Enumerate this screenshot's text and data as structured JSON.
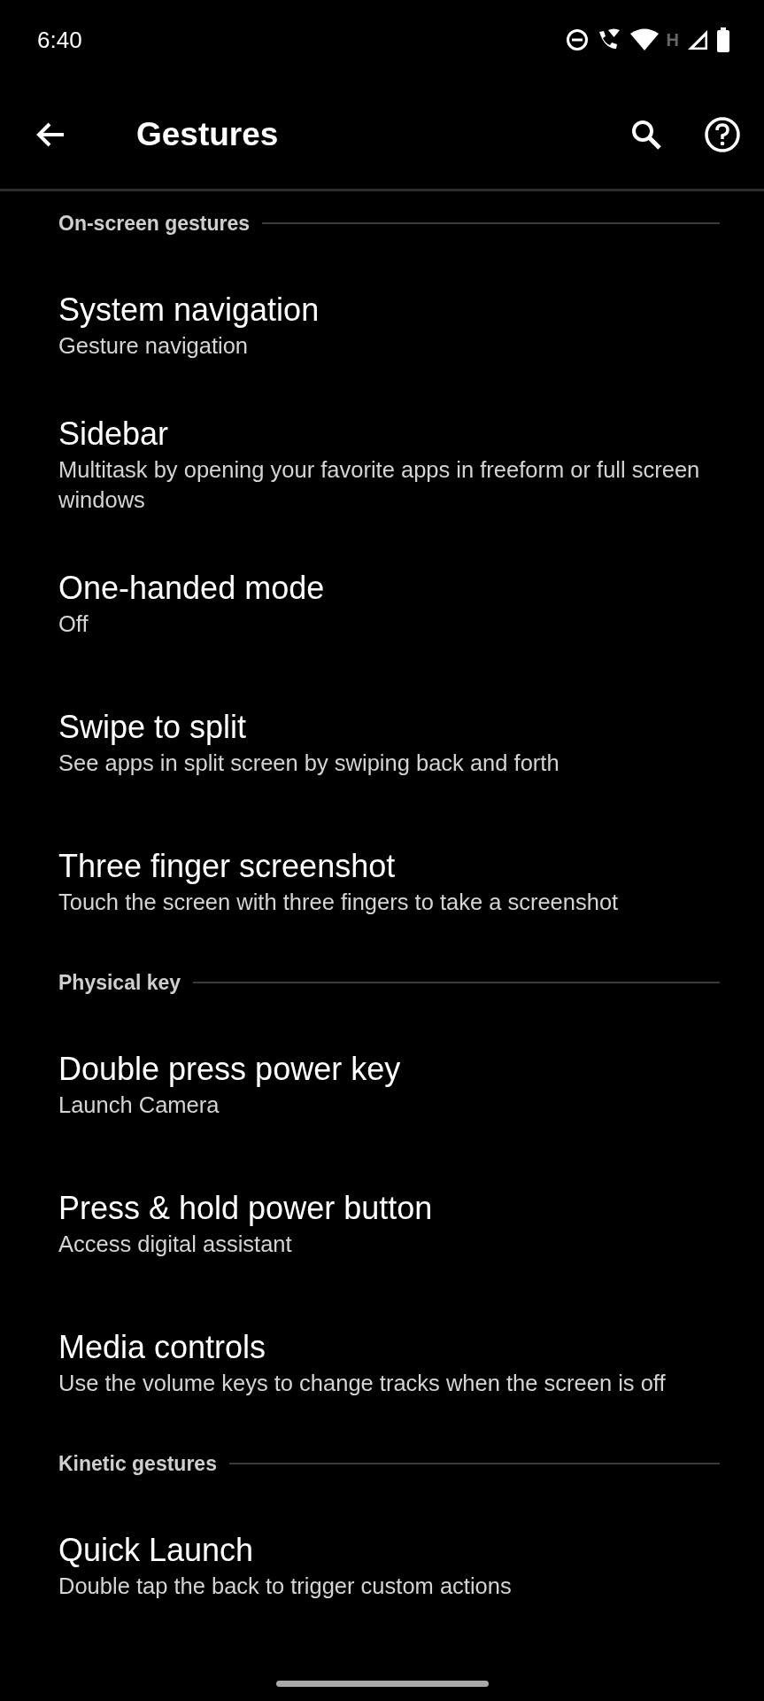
{
  "status_bar": {
    "time": "6:40",
    "network_type": "H"
  },
  "app_bar": {
    "title": "Gestures"
  },
  "sections": [
    {
      "title": "On-screen gestures",
      "items": [
        {
          "title": "System navigation",
          "summary": "Gesture navigation"
        },
        {
          "title": "Sidebar",
          "summary": "Multitask by opening your favorite apps in freeform or full screen windows"
        },
        {
          "title": "One-handed mode",
          "summary": "Off"
        },
        {
          "title": "Swipe to split",
          "summary": "See apps in split screen by swiping back and forth"
        },
        {
          "title": "Three finger screenshot",
          "summary": "Touch the screen with three fingers to take a screenshot"
        }
      ]
    },
    {
      "title": "Physical key",
      "items": [
        {
          "title": "Double press power key",
          "summary": "Launch Camera"
        },
        {
          "title": "Press & hold power button",
          "summary": "Access digital assistant"
        },
        {
          "title": "Media controls",
          "summary": "Use the volume keys to change tracks when the screen is off"
        }
      ]
    },
    {
      "title": "Kinetic gestures",
      "items": [
        {
          "title": "Quick Launch",
          "summary": "Double tap the back to trigger custom actions"
        }
      ]
    }
  ]
}
